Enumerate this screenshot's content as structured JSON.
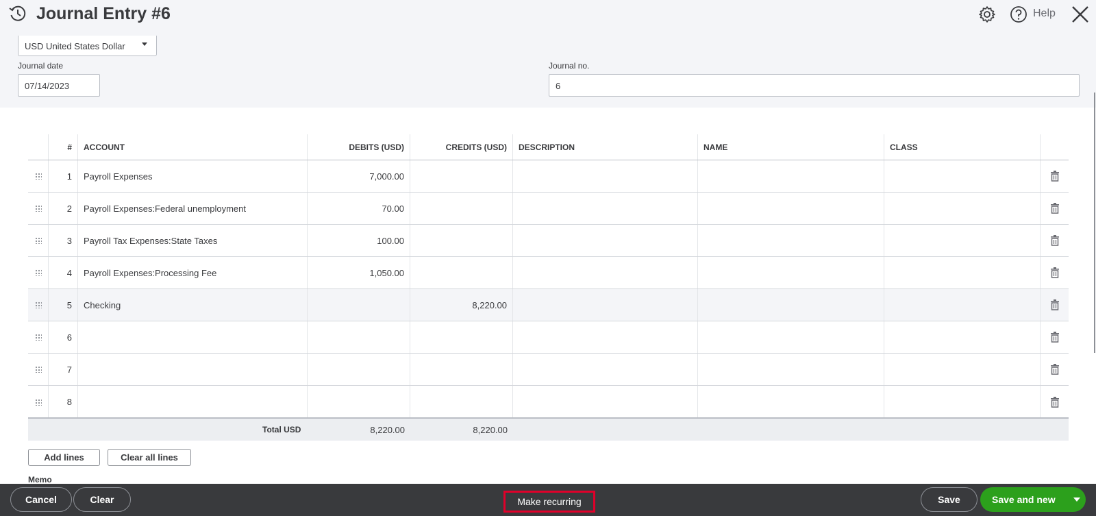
{
  "header": {
    "title": "Journal Entry #6",
    "help_label": "Help"
  },
  "form": {
    "currency": "USD United States Dollar",
    "journal_date_label": "Journal date",
    "journal_date": "07/14/2023",
    "journal_no_label": "Journal no.",
    "journal_no": "6"
  },
  "table": {
    "columns": [
      "#",
      "ACCOUNT",
      "DEBITS (USD)",
      "CREDITS (USD)",
      "DESCRIPTION",
      "NAME",
      "CLASS"
    ],
    "rows": [
      {
        "num": "1",
        "account": "Payroll Expenses",
        "debit": "7,000.00",
        "credit": ""
      },
      {
        "num": "2",
        "account": "Payroll Expenses:Federal unemployment",
        "debit": "70.00",
        "credit": ""
      },
      {
        "num": "3",
        "account": "Payroll Tax Expenses:State Taxes",
        "debit": "100.00",
        "credit": ""
      },
      {
        "num": "4",
        "account": "Payroll Expenses:Processing Fee",
        "debit": "1,050.00",
        "credit": ""
      },
      {
        "num": "5",
        "account": "Checking",
        "debit": "",
        "credit": "8,220.00"
      },
      {
        "num": "6",
        "account": "",
        "debit": "",
        "credit": ""
      },
      {
        "num": "7",
        "account": "",
        "debit": "",
        "credit": ""
      },
      {
        "num": "8",
        "account": "",
        "debit": "",
        "credit": ""
      }
    ],
    "total_label": "Total USD",
    "total_debits": "8,220.00",
    "total_credits": "8,220.00"
  },
  "actions": {
    "add_lines": "Add lines",
    "clear_all_lines": "Clear all lines",
    "memo_label": "Memo"
  },
  "footer": {
    "cancel": "Cancel",
    "clear": "Clear",
    "make_recurring": "Make recurring",
    "save": "Save",
    "save_and_new": "Save and new"
  },
  "colors": {
    "accent_green": "#2ca01c",
    "footer_bg": "#393a3d",
    "highlight_red": "#e0002a"
  }
}
